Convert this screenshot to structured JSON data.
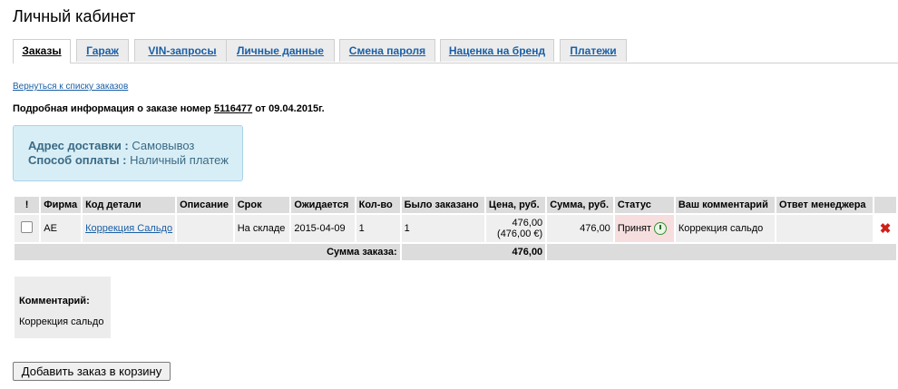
{
  "page": {
    "title": "Личный кабинет"
  },
  "tabs": [
    {
      "label": "Заказы",
      "active": true
    },
    {
      "label": "Гараж"
    },
    {
      "label": "VIN-запросы"
    },
    {
      "label": "Личные данные"
    },
    {
      "label": "Смена пароля"
    },
    {
      "label": "Наценка на бренд"
    },
    {
      "label": "Платежи"
    }
  ],
  "back_link": "Вернуться к списку заказов",
  "order": {
    "prefix": "Подробная информация о заказе номер ",
    "number": "5116477",
    "date_text": " от 09.04.2015г."
  },
  "delivery": {
    "address_label": "Адрес доставки :",
    "address_value": "Самовывоз",
    "payment_label": "Способ оплаты :",
    "payment_value": "Наличный платеж"
  },
  "table": {
    "headers": [
      "!",
      "Фирма",
      "Код детали",
      "Описание",
      "Срок",
      "Ожидается",
      "Кол-во",
      "Было заказано",
      "Цена, руб.",
      "Сумма, руб.",
      "Статус",
      "Ваш комментарий",
      "Ответ менеджера",
      ""
    ],
    "row": {
      "firm": "AE",
      "code": "Коррекция Сальдо",
      "description": "",
      "term": "На складе",
      "expected": "2015-04-09",
      "qty": "1",
      "ordered": "1",
      "price": "476,00",
      "price_eur": "(476,00 €)",
      "sum": "476,00",
      "status": "Принят",
      "comment": "Коррекция сальдо",
      "manager_answer": ""
    },
    "total_label": "Сумма заказа:",
    "total_value": "476,00"
  },
  "comment": {
    "label": "Комментарий:",
    "text": "Коррекция сальдо"
  },
  "add_button": "Добавить заказ в корзину",
  "colors": {
    "link": "#1a5fa6",
    "delivery_bg": "#d8eef6",
    "status_bg": "#f6dede",
    "delete": "#d0201a"
  }
}
